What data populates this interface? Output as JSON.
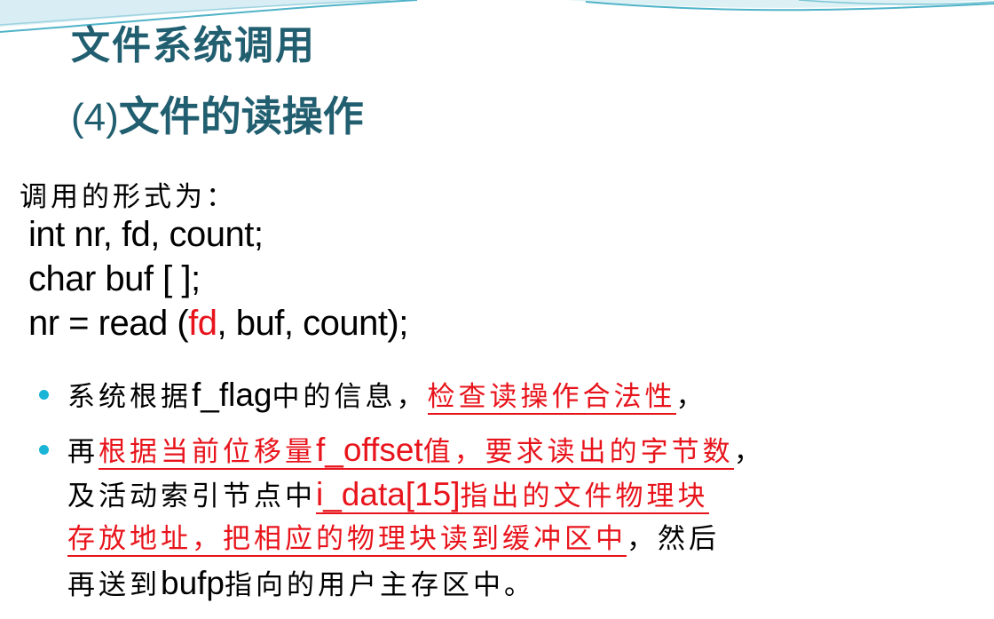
{
  "title": {
    "line1": "文件系统调用",
    "line2_prefix": "(4)",
    "line2_rest": "文件的读操作"
  },
  "intro": "调用的形式为：",
  "code": {
    "line1": "int nr, fd, count;",
    "line2": "char buf [  ];",
    "line3_pre": "nr = read (",
    "line3_red": "fd",
    "line3_post": ", buf, count);"
  },
  "bullets": {
    "b1": {
      "t1": "系统根据",
      "t2": "f_flag",
      "t3": "中的信息，",
      "red": "检查读操作合法性",
      "t4": "，"
    },
    "b2": {
      "t1": "再",
      "red1": "根据当前位移量",
      "red1_latin": "f_offset",
      "red1_end": "值，要求读出的字节数",
      "t2": "，",
      "t3": "及活动索引节点中",
      "red2_latin": "i_data[15]",
      "red2_end": "指出的文件物理块",
      "red3": "存放地址，把相应的物理块读到缓冲区中",
      "t4": "，然后",
      "t5": "再送到",
      "t5_latin": "bufp",
      "t6": "指向的用户主存区中。"
    }
  },
  "colors": {
    "title": "#215f70",
    "accent_red": "#e8141c",
    "bullet": "#1ab5d6",
    "decor": "#4fb3c8"
  }
}
